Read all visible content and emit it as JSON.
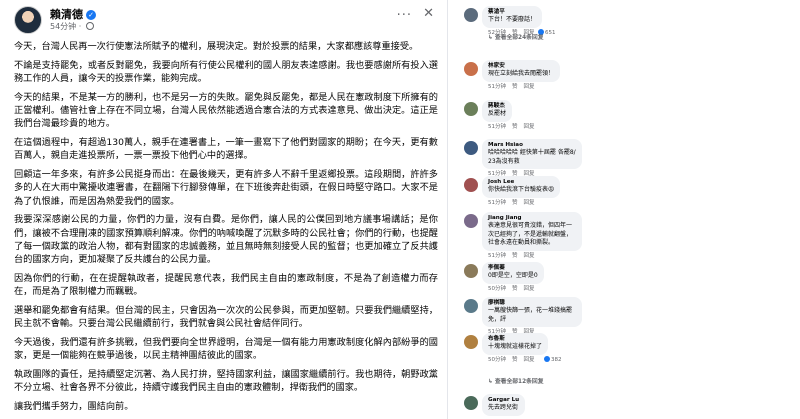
{
  "post": {
    "author": "賴清德",
    "time": "54分钟",
    "paragraphs": [
      "今天，台灣人民再一次行使憲法所賦予的權利，展現決定。對於投票的結果，大家都應該尊重接受。",
      "不論是支持罷免，或者反對罷免，我要向所有行使公民權利的國人朋友表達感謝。我也要感謝所有投入選務工作的人員，讓今天的投票作業，能夠完成。",
      "今天的結果，不是某一方的勝利，也不是另一方的失敗。罷免與反罷免，都是人民在憲政制度下所擁有的正當權利。儘管社會上存在不同立場，台灣人民依然能透過合憲合法的方式表達意見、做出決定。這正是我們台灣最珍貴的地方。",
      "在這個過程中，有超過130萬人，親手在連署書上，一筆一畫寫下了他們對國家的期盼；在今天，更有數百萬人，親自走進投票所，一票一票投下他們心中的選擇。",
      "回顧這一年多來，有許多公民挺身而出：在最後幾天，更有許多人不辭千里返鄉投票。這段期間，許許多多的人在大雨中驚擾收連署書，在翻陽下行腳發傳單，在下班後奔赴街頭，在假日時堅守路口。大家不是為了仇恨誰，而是因為熱愛我們的國家。",
      "我要深深感謝公民的力量，你們的力量，沒有白費。是你們，讓人民的公僕回到地方議事場講話；是你們，讓被不合理刪凍的國家預算順利解凍。你們的吶喊喚醒了沉默多時的公民社會；你們的行動，也提醒了每一個政黨的政治人物，都有對國家的忠誠義務，並且無時無刻接受人民的監督；也更加確立了反共護台的國家方向，更加凝聚了反共護台的公民力量。",
      "因為你們的行動，在在提醒執政者，提醒民意代表，我們民主自由的憲政制度，不是為了創造權力而存在，而是為了限制權力而羈戰。",
      "選舉和罷免都會有結果。但台灣的民主，只會因為一次次的公民參與，而更加堅韌。只要我們繼續堅持，民主就不會輸。只要台灣公民繼續前行，我們就會與公民社會結伴同行。",
      "今天過後，我們還有許多挑戰，但我們要向全世界證明，台灣是一個有能力用憲政制度化解內部紛爭的國家，更是一個能夠在競爭過後，以民主精神團結彼此的國家。",
      "執政團隊的責任，是持續堅定沉著、為人民打拚，堅持國家利益，讓國家繼續前行。我也期待，朝野政黨不分立場、社會各界不分彼此，持續守護我們民主自由的憲政體制，捍衛我們的國家。",
      "讓我們攜手努力，團結向前。"
    ]
  },
  "comments": [
    {
      "name": "蔡滄平",
      "text": "下台！不要廢話！",
      "time": "52分钟",
      "actions": [
        "赞",
        "回复"
      ],
      "reactions": "651",
      "color": "#5b6b7c"
    },
    {
      "view_replies": "查看全部24条回复"
    },
    {
      "name": "林家安",
      "text": "現在立刻給我去閱罷領！",
      "time": "51分钟",
      "actions": [
        "赞",
        "回复"
      ],
      "reactions": "",
      "color": "#c9704a"
    },
    {
      "name": "蔣駿杰",
      "text": "反罷材",
      "time": "51分钟",
      "actions": [
        "赞",
        "回复"
      ],
      "reactions": "",
      "color": "#6b7f5a"
    },
    {
      "name": "Mars Hsiao",
      "text": "哈哈哈哈哈 經快第十屆罷 各罷8/23為沒有救",
      "time": "51分钟",
      "actions": [
        "赞",
        "回复"
      ],
      "reactions": "",
      "color": "#3d5a80"
    },
    {
      "name": "Josh Lee",
      "text": "你快給我滾下台驗疫表😡",
      "time": "51分钟",
      "actions": [
        "赞",
        "回复"
      ],
      "reactions": "",
      "color": "#a05050"
    },
    {
      "name": "Jiang Jiang",
      "text": "表達意見很可貴沒錯，但四年一次已經夠了，不是遞輸就翻盤，社會永遠在動員和撕裂。",
      "time": "51分钟",
      "actions": [
        "赞",
        "回复"
      ],
      "reactions": "",
      "color": "#7a6a8a"
    },
    {
      "name": "李佩蓁",
      "text": "0即是空，空即是0",
      "time": "50分钟",
      "actions": [
        "赞",
        "回复"
      ],
      "reactions": "",
      "color": "#8a7a5a"
    },
    {
      "name": "廖棋聰",
      "text": "一萬艘快篩一張，花一堆錢搞罷免，評",
      "time": "51分钟",
      "actions": [
        "赞",
        "回复"
      ],
      "reactions": "",
      "color": "#5a7a8a"
    },
    {
      "name": "布魯斯",
      "text": "十塊塊就這樣花掉了",
      "time": "50分钟",
      "actions": [
        "赞",
        "回复"
      ],
      "reactions": "382",
      "color": "#b08040"
    },
    {
      "view_replies": "查看全部12条回复"
    },
    {
      "name": "Gargar Lu",
      "text": "先去跨兒街",
      "time": "",
      "actions": [],
      "reactions": "",
      "color": "#4a6a5a"
    }
  ],
  "labels": {
    "like": "赞",
    "reply": "回复",
    "more": "···",
    "close": "✕"
  }
}
